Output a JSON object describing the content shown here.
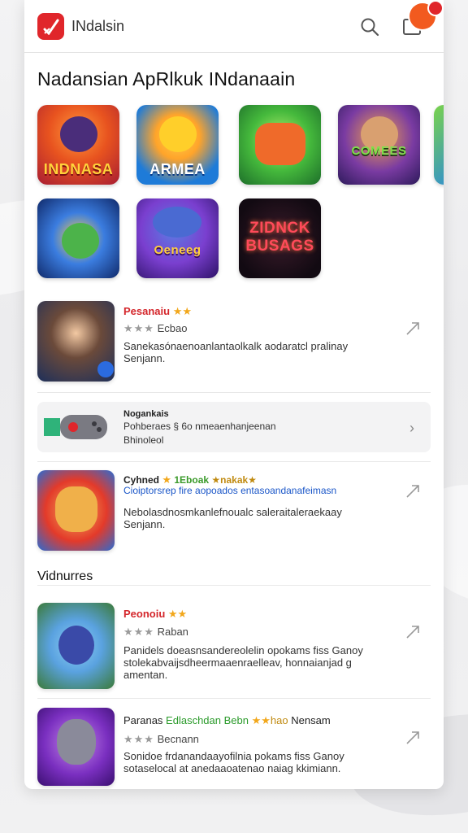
{
  "header": {
    "title": "INdalsin",
    "icons": [
      "app-logo-icon",
      "search-icon",
      "mail-icon"
    ],
    "badge_color": "#f25a1f",
    "accent": "#e0262b"
  },
  "section_title": "Nadansian ApRlkuk INdanaain",
  "tiles": [
    {
      "label": "INDNASA"
    },
    {
      "label": "ARMEA"
    },
    {
      "label": ""
    },
    {
      "label": "COMEES"
    },
    {
      "label": ""
    },
    {
      "label": ""
    },
    {
      "label": "Oeneeg"
    },
    {
      "label": "ZIDNCK BUSAGS"
    }
  ],
  "items": [
    {
      "name": "Pesanaiu",
      "stars": "★★",
      "rating_stars": "★★★",
      "sub": "Ecbao",
      "desc": "Sanekasónaenoanlantaolkalk aodaratcl pralinay Senjann."
    },
    {
      "name": "Cyhned",
      "extra1": "1Eboak",
      "stars": "★",
      "extra2": "★nakak★",
      "sub": "Cioiptorsrep fire aopoados entasoandanafeimasn",
      "desc": "Nebolasdnosmkanlefnoualc saleraitaleraekaay Senjann."
    },
    {
      "name": "Peonoiu",
      "stars": "★★",
      "rating_stars": "★★★",
      "sub": "Raban",
      "desc": "Panidels doeasnsandereolelin opokams fiss Ganoy stolekabvaijsdheermaaenraelleav, honnaianjad g amentan."
    },
    {
      "name": "Paranas",
      "extra1": "Edlaschdan Bebn",
      "stars": "★★",
      "extra2": "hao",
      "extra3": "Nensam",
      "rating_stars": "★★★",
      "sub": "Becnann",
      "desc": "Sonidoe frdanandaayofilnia pokams fiss Ganoy sotaselocal at anedaaoatenao naiag kkimiann."
    }
  ],
  "banner": {
    "title": "Nogankais",
    "line1": "Pohberaes § 6o nmeaenhanjeenan",
    "line2": "Bhinoleol"
  },
  "subhead": "Vidnurres"
}
